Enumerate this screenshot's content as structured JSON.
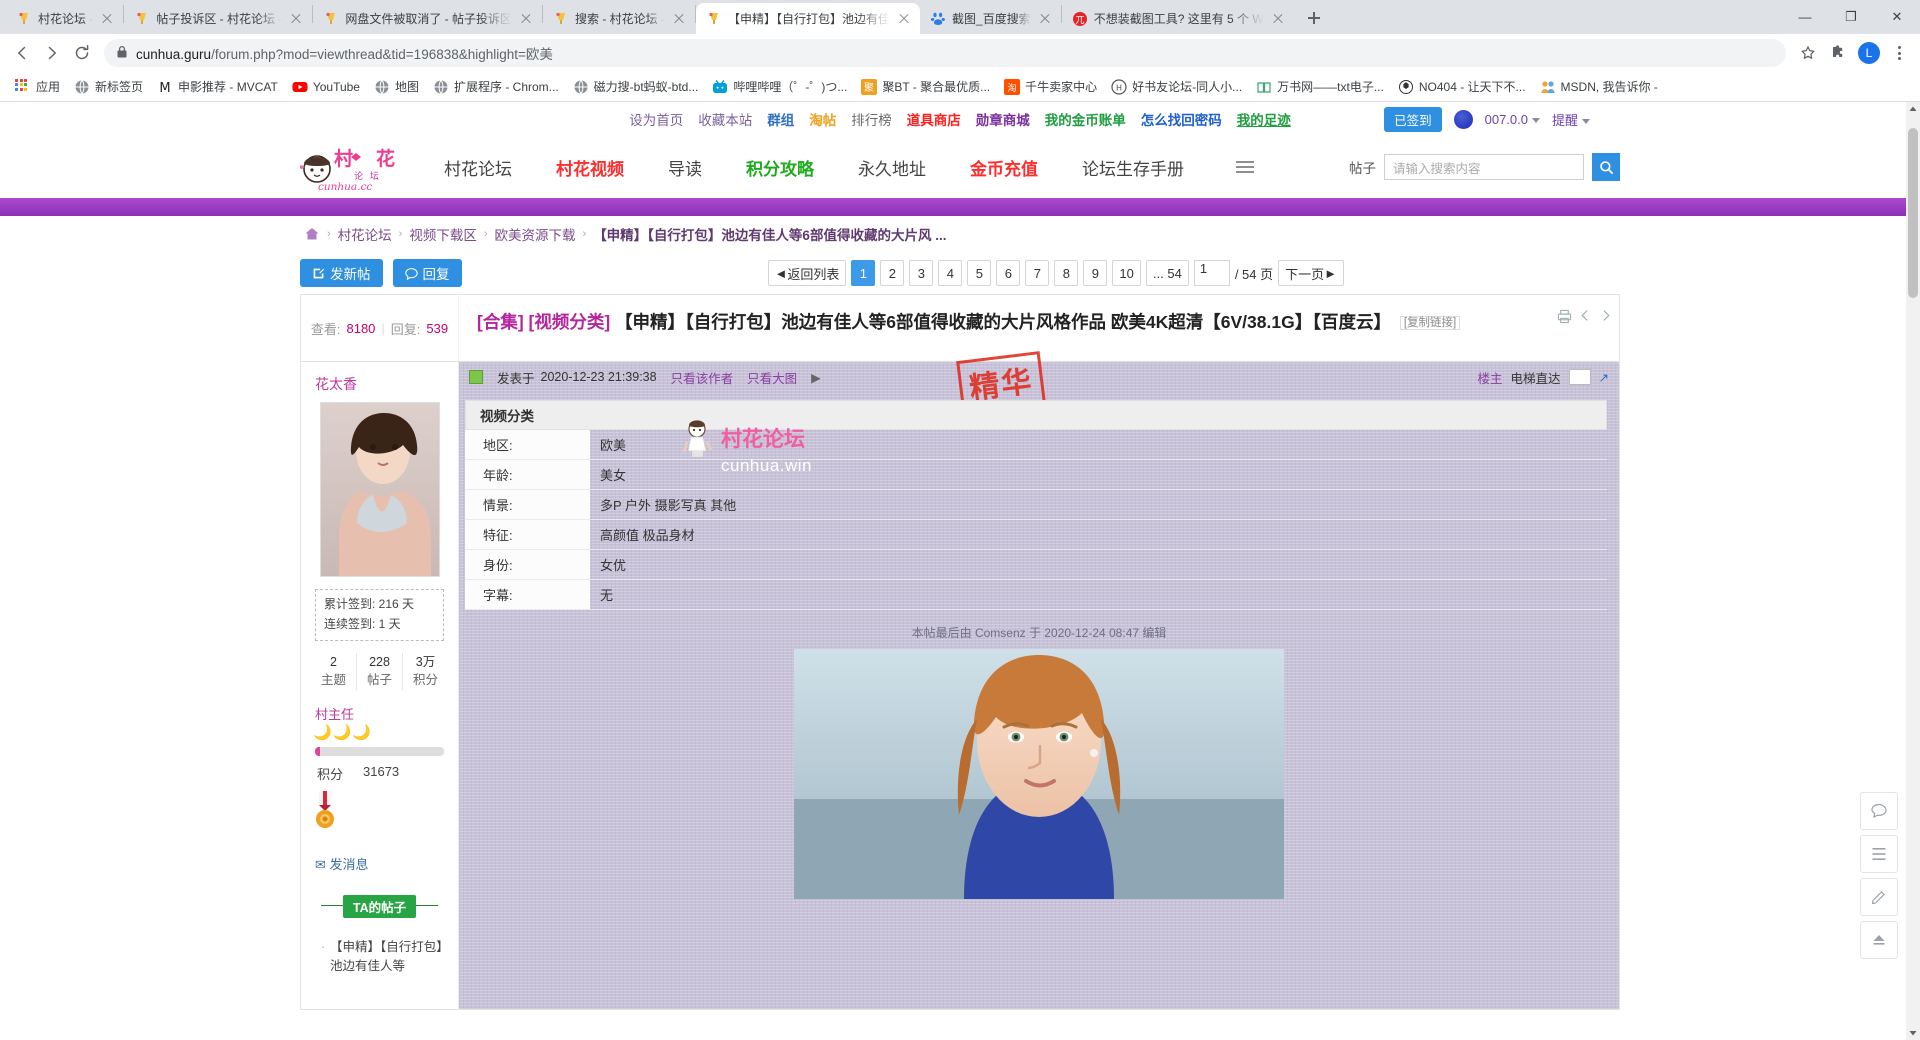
{
  "browser": {
    "tabs": [
      {
        "title": "村花论坛 -",
        "favicon": "forum-icon",
        "active": false
      },
      {
        "title": "帖子投诉区 - 村花论坛 -",
        "favicon": "forum-icon",
        "active": false
      },
      {
        "title": "网盘文件被取消了 - 帖子投诉区",
        "favicon": "forum-icon",
        "active": false
      },
      {
        "title": "搜索 - 村花论坛 -",
        "favicon": "forum-icon",
        "active": false
      },
      {
        "title": "【申精】【自行打包】池边有佳",
        "favicon": "forum-icon",
        "active": true
      },
      {
        "title": "截图_百度搜索",
        "favicon": "baidu-icon",
        "active": false
      },
      {
        "title": "不想装截图工具? 这里有 5 个 W",
        "favicon": "red-icon",
        "active": false
      }
    ],
    "new_tab_label": "+",
    "window_minimize": "—",
    "window_maximize": "❐",
    "window_close": "✕",
    "url_host": "cunhua.guru",
    "url_rest": "/forum.php?mod=viewthread&tid=196838&highlight=欧美",
    "avatar_letter": "L",
    "bookmarks": [
      {
        "label": "应用",
        "icon": "apps-grid-icon",
        "color": "#4285f4"
      },
      {
        "label": "新标签页",
        "icon": "globe-icon",
        "color": "#8a8f95"
      },
      {
        "label": "申影推荐 - MVCAT",
        "icon": "mvcat-icon",
        "color": "#2b2b2b"
      },
      {
        "label": "YouTube",
        "icon": "youtube-icon",
        "color": "#ff0000"
      },
      {
        "label": "地图",
        "icon": "globe-icon",
        "color": "#8a8f95"
      },
      {
        "label": "扩展程序 - Chrom...",
        "icon": "globe-icon",
        "color": "#8a8f95"
      },
      {
        "label": "磁力搜-bt蚂蚁-btd...",
        "icon": "globe-icon",
        "color": "#8a8f95"
      },
      {
        "label": "哔哩哔哩（゜-゜)つ...",
        "icon": "bilibili-icon",
        "color": "#00a1d6"
      },
      {
        "label": "聚BT - 聚合最优质...",
        "icon": "jubt-icon",
        "color": "#f0a020"
      },
      {
        "label": "千牛卖家中心",
        "icon": "taobao-icon",
        "color": "#ff5000"
      },
      {
        "label": "好书友论坛-同人小...",
        "icon": "book-icon",
        "color": "#2f6fa8"
      },
      {
        "label": "万书网——txt电子...",
        "icon": "wanshu-icon",
        "color": "#3aa56d"
      },
      {
        "label": "NO404 - 让天下不...",
        "icon": "no404-icon",
        "color": "#333333"
      },
      {
        "label": "MSDN, 我告诉你 -",
        "icon": "msdn-icon",
        "color": "#f2a33c"
      }
    ]
  },
  "topbar": {
    "links": [
      {
        "label": "设为首页",
        "color": "#7a5fa0"
      },
      {
        "label": "收藏本站",
        "color": "#7a5fa0"
      },
      {
        "label": "群组",
        "color": "#2f6fc4",
        "bold": true
      },
      {
        "label": "淘帖",
        "color": "#f0a020",
        "bold": true
      },
      {
        "label": "排行榜",
        "color": "#6b6b6b"
      },
      {
        "label": "道具商店",
        "color": "#ff2020",
        "bold": true
      },
      {
        "label": "勋章商城",
        "color": "#7a2f9e",
        "bold": true
      },
      {
        "label": "我的金币账单",
        "color": "#1f9e3f",
        "bold": true
      },
      {
        "label": "怎么找回密码",
        "color": "#1f5fd0",
        "bold": true
      },
      {
        "label": "我的足迹",
        "color": "#1f9e3f",
        "bold": true
      }
    ],
    "signed_label": "已签到",
    "username": "007.0.0",
    "notify_label": "提醒"
  },
  "header": {
    "logo_main": "村 花",
    "logo_sub": "论 坛",
    "logo_domain": "cunhua.cc",
    "nav": [
      {
        "label": "村花论坛",
        "style": "gray"
      },
      {
        "label": "村花视频",
        "style": "red"
      },
      {
        "label": "导读",
        "style": "gray"
      },
      {
        "label": "积分攻略",
        "style": "green"
      },
      {
        "label": "永久地址",
        "style": "gray"
      },
      {
        "label": "金币充值",
        "style": "red"
      },
      {
        "label": "论坛生存手册",
        "style": "gray"
      }
    ],
    "search_label": "帖子",
    "search_placeholder": "请输入搜索内容",
    "search_value": ""
  },
  "breadcrumb": [
    "村花论坛",
    "视频下载区",
    "欧美资源下载",
    "【申精】【自行打包】池边有佳人等6部值得收藏的大片风 ..."
  ],
  "actions": {
    "new_post": "发新帖",
    "reply": "回复"
  },
  "pagination": {
    "back_to_list": "返回列表",
    "pages": [
      "1",
      "2",
      "3",
      "4",
      "5",
      "6",
      "7",
      "8",
      "9",
      "10"
    ],
    "ellipsis": "... 54",
    "current": "1",
    "input_value": "1",
    "total_text": "/ 54 页",
    "next_page": "下一页"
  },
  "thread": {
    "views_label": "查看:",
    "views": "8180",
    "replies_label": "回复:",
    "replies": "539",
    "category": "[合集] [视频分类]",
    "title": "【申精】【自行打包】池边有佳人等6部值得收藏的大片风格作品 欧美4K超清【6V/38.1G】【百度云】",
    "copy_link": "[复制链接]"
  },
  "post": {
    "posted_prefix": "发表于",
    "posted_time": "2020-12-23 21:39:38",
    "only_author": "只看该作者",
    "only_images": "只看大图",
    "stamp": "精华",
    "floor_owner": "楼主",
    "elevator": "电梯直达",
    "elevator_value": "",
    "edited_note": "本帖最后由 Comsenz 于 2020-12-24 08:47 编辑",
    "info_title": "视频分类",
    "info_rows": [
      {
        "key": "地区:",
        "value": "欧美"
      },
      {
        "key": "年龄:",
        "value": "美女"
      },
      {
        "key": "情景:",
        "value": "多P 户外 摄影写真 其他"
      },
      {
        "key": "特征:",
        "value": "高颜值 极品身材"
      },
      {
        "key": "身份:",
        "value": "女优"
      },
      {
        "key": "字幕:",
        "value": "无"
      }
    ],
    "watermark_main": "村花论坛",
    "watermark_sub": "cunhua.win"
  },
  "author": {
    "name": "花太香",
    "signin_total": "累计签到: 216 天",
    "signin_streak": "连续签到: 1 天",
    "stats": [
      {
        "value": "2",
        "label": "主题"
      },
      {
        "value": "228",
        "label": "帖子"
      },
      {
        "value": "3万",
        "label": "积分"
      }
    ],
    "rank": "村主任",
    "points_label": "积分",
    "points_value": "31673",
    "send_message": "发消息",
    "ta_posts_tag": "TA的帖子",
    "ta_posts": [
      "【申精】【自行打包】池边有佳人等"
    ]
  },
  "rail": {
    "items": [
      "chat-icon",
      "list-icon",
      "edit-icon",
      "top-arrow-icon"
    ]
  },
  "colors": {
    "accent_blue": "#2f8fe0",
    "brand_pink": "#ef5fa0",
    "link_purple": "#7a4b8a",
    "band": "#9a3cc0"
  }
}
